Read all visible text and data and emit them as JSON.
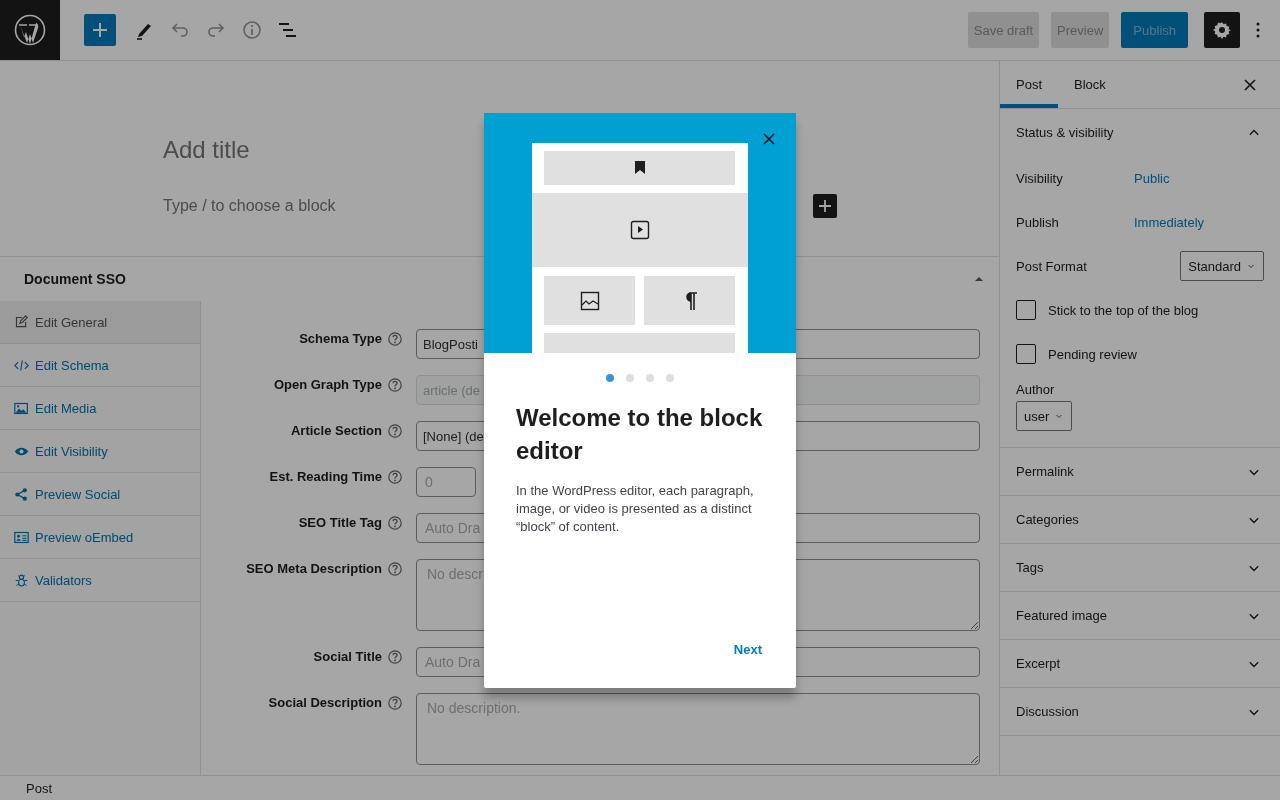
{
  "toolbar": {
    "undo": {
      "disabled": true
    },
    "redo": {
      "disabled": true
    },
    "actions": [
      {
        "label": "Save draft",
        "kind": "secondary"
      },
      {
        "label": "Preview",
        "kind": "secondary"
      },
      {
        "label": "Publish",
        "kind": "primary"
      }
    ],
    "settings": {
      "pressed": true
    }
  },
  "editor": {
    "title_placeholder": "Add title",
    "block_placeholder": "Type / to choose a block"
  },
  "metabox": {
    "title": "Document SSO",
    "expanded": true,
    "tabs": [
      {
        "label": "Edit General",
        "selected": true
      },
      {
        "label": "Edit Schema",
        "selected": false
      },
      {
        "label": "Edit Media",
        "selected": false
      },
      {
        "label": "Edit Visibility",
        "selected": false
      },
      {
        "label": "Preview Social",
        "selected": false
      },
      {
        "label": "Preview oEmbed",
        "selected": false
      },
      {
        "label": "Validators",
        "selected": false
      }
    ],
    "fields": [
      {
        "label": "Schema Type",
        "kind": "select",
        "value": "BlogPosti",
        "disabled": false
      },
      {
        "label": "Open Graph Type",
        "kind": "select",
        "value": "article (de",
        "disabled": true
      },
      {
        "label": "Article Section",
        "kind": "select",
        "value": "[None] (de",
        "disabled": false
      },
      {
        "label": "Est. Reading Time",
        "kind": "number",
        "placeholder": "0",
        "disabled": false
      },
      {
        "label": "SEO Title Tag",
        "kind": "text",
        "placeholder": "Auto Dra",
        "disabled": false
      },
      {
        "label": "SEO Meta Description",
        "kind": "textarea",
        "placeholder": "No descr",
        "disabled": false
      },
      {
        "label": "Social Title",
        "kind": "text",
        "placeholder": "Auto Dra",
        "disabled": false
      },
      {
        "label": "Social Description",
        "kind": "textarea",
        "placeholder": "No description.",
        "disabled": false
      }
    ]
  },
  "sidebar": {
    "tabs": [
      {
        "label": "Post",
        "selected": true
      },
      {
        "label": "Block",
        "selected": false
      }
    ],
    "status_panel": {
      "title": "Status & visibility",
      "expanded": true,
      "rows": [
        {
          "label": "Visibility",
          "value": "Public"
        },
        {
          "label": "Publish",
          "value": "Immediately"
        }
      ],
      "post_format": {
        "label": "Post Format",
        "value": "Standard"
      },
      "checkboxes": [
        {
          "label": "Stick to the top of the blog",
          "checked": false
        },
        {
          "label": "Pending review",
          "checked": false
        }
      ],
      "author": {
        "label": "Author",
        "value": "user"
      }
    },
    "panels": [
      {
        "title": "Permalink",
        "expanded": false
      },
      {
        "title": "Categories",
        "expanded": false
      },
      {
        "title": "Tags",
        "expanded": false
      },
      {
        "title": "Featured image",
        "expanded": false
      },
      {
        "title": "Excerpt",
        "expanded": false
      },
      {
        "title": "Discussion",
        "expanded": false
      }
    ]
  },
  "status_bar": {
    "label": "Post"
  },
  "modal": {
    "title": "Welcome to the block editor",
    "body": "In the WordPress editor, each paragraph, image, or video is presented as a distinct “block” of content.",
    "next_label": "Next",
    "pages": [
      {
        "selected": true
      },
      {
        "selected": false
      },
      {
        "selected": false
      },
      {
        "selected": false
      }
    ]
  }
}
